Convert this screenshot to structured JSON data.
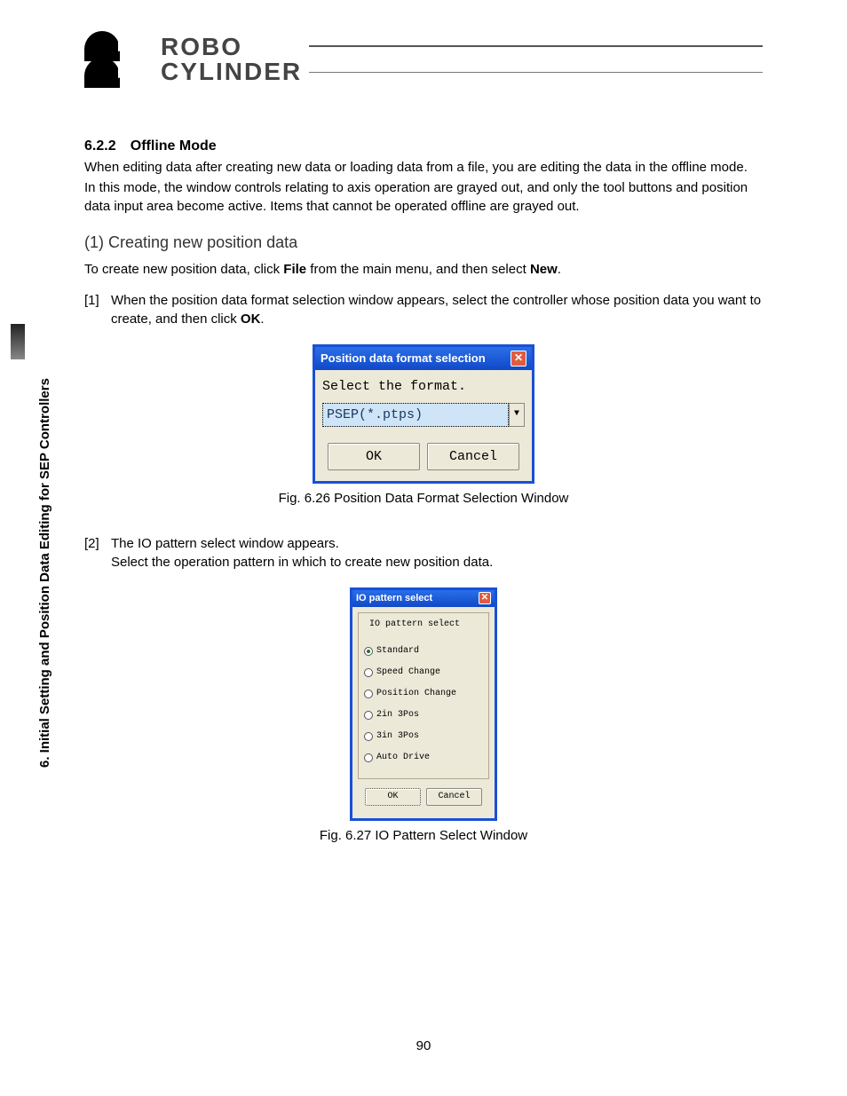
{
  "header": {
    "logo_line1": "ROBO",
    "logo_line2": "CYLINDER"
  },
  "sidebar": {
    "chapter": "6. Initial Setting and Position Data Editing for SEP Controllers"
  },
  "section": {
    "number": "6.2.2",
    "title": "Offline Mode",
    "para1": "When editing data after creating new data or loading data from a file, you are editing the data in the offline mode.",
    "para2": "In this mode, the window controls relating to axis operation are grayed out, and only the tool buttons and position data input area become active. Items that cannot be operated offline are grayed out.",
    "sub1_number": "(1)",
    "sub1_title": "Creating new position data",
    "sub1_intro_a": "To create new position data, click ",
    "sub1_intro_file": "File",
    "sub1_intro_b": " from the main menu, and then select ",
    "sub1_intro_new": "New",
    "sub1_intro_c": ".",
    "step1_num": "[1]",
    "step1_a": "When the position data format selection window appears, select the controller whose position data you want to create, and then click ",
    "step1_ok": "OK",
    "step1_b": ".",
    "step2_num": "[2]",
    "step2_a": "The IO pattern select window appears.",
    "step2_b": "Select the operation pattern in which to create new position data."
  },
  "dialog1": {
    "title": "Position data format selection",
    "label": "Select the format.",
    "selected": "PSEP(*.ptps)",
    "ok": "OK",
    "cancel": "Cancel",
    "caption": "Fig. 6.26 Position Data Format Selection Window"
  },
  "dialog2": {
    "title": "IO pattern select",
    "group_title": "IO pattern select",
    "options": [
      "Standard",
      "Speed Change",
      "Position Change",
      "2in 3Pos",
      "3in 3Pos",
      "Auto Drive"
    ],
    "selected_index": 0,
    "ok": "OK",
    "cancel": "Cancel",
    "caption": "Fig. 6.27 IO Pattern Select Window"
  },
  "page_number": "90"
}
